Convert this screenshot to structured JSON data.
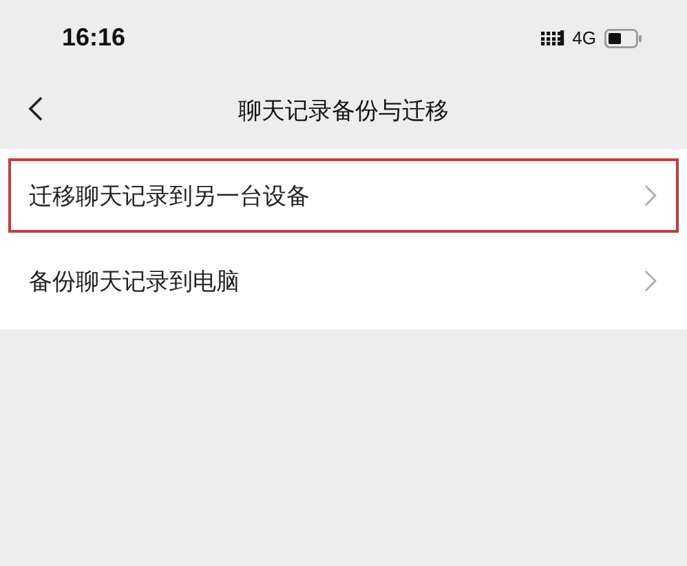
{
  "status_bar": {
    "time": "16:16",
    "network": "4G"
  },
  "nav_bar": {
    "title": "聊天记录备份与迁移"
  },
  "items": [
    {
      "label": "迁移聊天记录到另一台设备",
      "highlighted": true
    },
    {
      "label": "备份聊天记录到电脑",
      "highlighted": false
    }
  ]
}
